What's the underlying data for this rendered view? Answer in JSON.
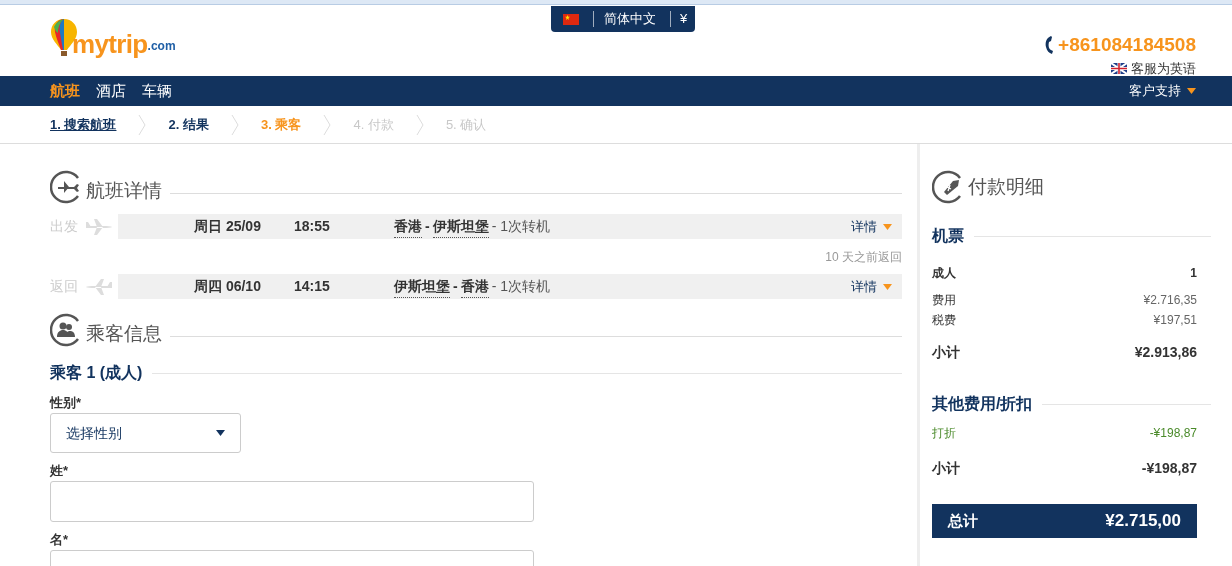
{
  "header": {
    "logo": {
      "word": "mytrip",
      "suffix": ".com"
    },
    "locale": {
      "language": "简体中文",
      "currency": "¥"
    },
    "phone": "+861084184508",
    "support_language": "客服为英语"
  },
  "nav": {
    "items": [
      {
        "label": "航班",
        "selected": true
      },
      {
        "label": "酒店",
        "selected": false
      },
      {
        "label": "车辆",
        "selected": false
      }
    ],
    "support_menu": "客户支持"
  },
  "steps": [
    {
      "label": "1. 搜索航班",
      "kind": "link"
    },
    {
      "label": "2. 结果",
      "kind": "done"
    },
    {
      "label": "3. 乘客",
      "kind": "current"
    },
    {
      "label": "4. 付款",
      "kind": "pending"
    },
    {
      "label": "5. 确认",
      "kind": "pending"
    }
  ],
  "flight_details": {
    "title": "航班详情",
    "legs": [
      {
        "kind": "outbound",
        "label": "出发",
        "date": "周日 25/09",
        "time": "18:55",
        "from": "香港",
        "separator": "-",
        "to": "伊斯坦堡",
        "stops": "- 1次转机",
        "details_link": "详情"
      },
      {
        "kind": "return",
        "label": "返回",
        "date": "周四 06/10",
        "time": "14:15",
        "from": "伊斯坦堡",
        "separator": "-",
        "to": "香港",
        "stops": "- 1次转机",
        "details_link": "详情"
      }
    ],
    "return_note": "10 天之前返回"
  },
  "passengers": {
    "title": "乘客信息",
    "passenger_title": "乘客 1 (成人)",
    "fields": [
      {
        "kind": "select",
        "label": "性别*",
        "placeholder": "选择性别"
      },
      {
        "kind": "text",
        "label": "姓*"
      },
      {
        "kind": "text",
        "label": "名*"
      }
    ]
  },
  "payment": {
    "title": "付款明细",
    "sections": [
      {
        "title": "机票",
        "rows": [
          {
            "kind": "bold",
            "label": "成人",
            "value": "1"
          },
          {
            "kind": "plain",
            "label": "费用",
            "value": "¥2.716,35"
          },
          {
            "kind": "plain",
            "label": "税费",
            "value": "¥197,51"
          },
          {
            "kind": "subtotal",
            "label": "小计",
            "value": "¥2.913,86"
          }
        ]
      },
      {
        "title": "其他费用/折扣",
        "rows": [
          {
            "kind": "discount",
            "label": "打折",
            "value": "-¥198,87"
          },
          {
            "kind": "subtotal",
            "label": "小计",
            "value": "-¥198,87"
          }
        ]
      }
    ],
    "total": {
      "label": "总计",
      "value": "¥2.715,00"
    }
  }
}
